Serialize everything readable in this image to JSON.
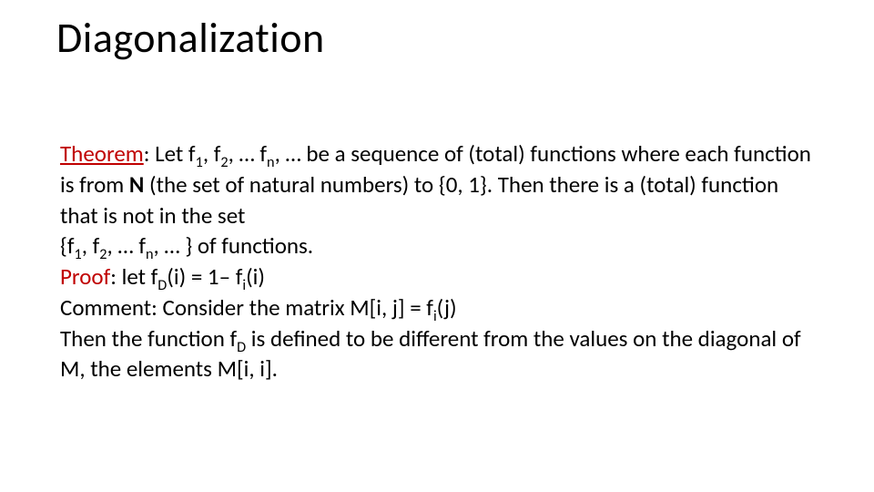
{
  "title": "Diagonalization",
  "theorem_label": "Theorem",
  "colon_space": ": ",
  "sentence_let": "Let f",
  "s1": "1",
  "comma_f": ", f",
  "s2": "2",
  "ellipsis_f": ", … f",
  "sn": "n",
  "seq_tail": ", … be a sequence of (total) functions where each function is from ",
  "bold_N": "N",
  "after_N": " (the set of natural numbers) to {0, 1}. Then there is a (total) function that is not in the set",
  "set_open": "{f",
  "set_close": ", … } of functions.",
  "proof_label": "Proof",
  "proof_text_a": ": let f",
  "subD": "D",
  "proof_text_b": "(i) = 1– f",
  "subi": "i",
  "proof_text_c": "(i)",
  "comment_a": "Comment: Consider the matrix M[i, j] = f",
  "comment_b": "(j)",
  "then_a": "Then the function f",
  "then_b": " is defined to be different from the values on the diagonal of M, the elements M[i, i]."
}
